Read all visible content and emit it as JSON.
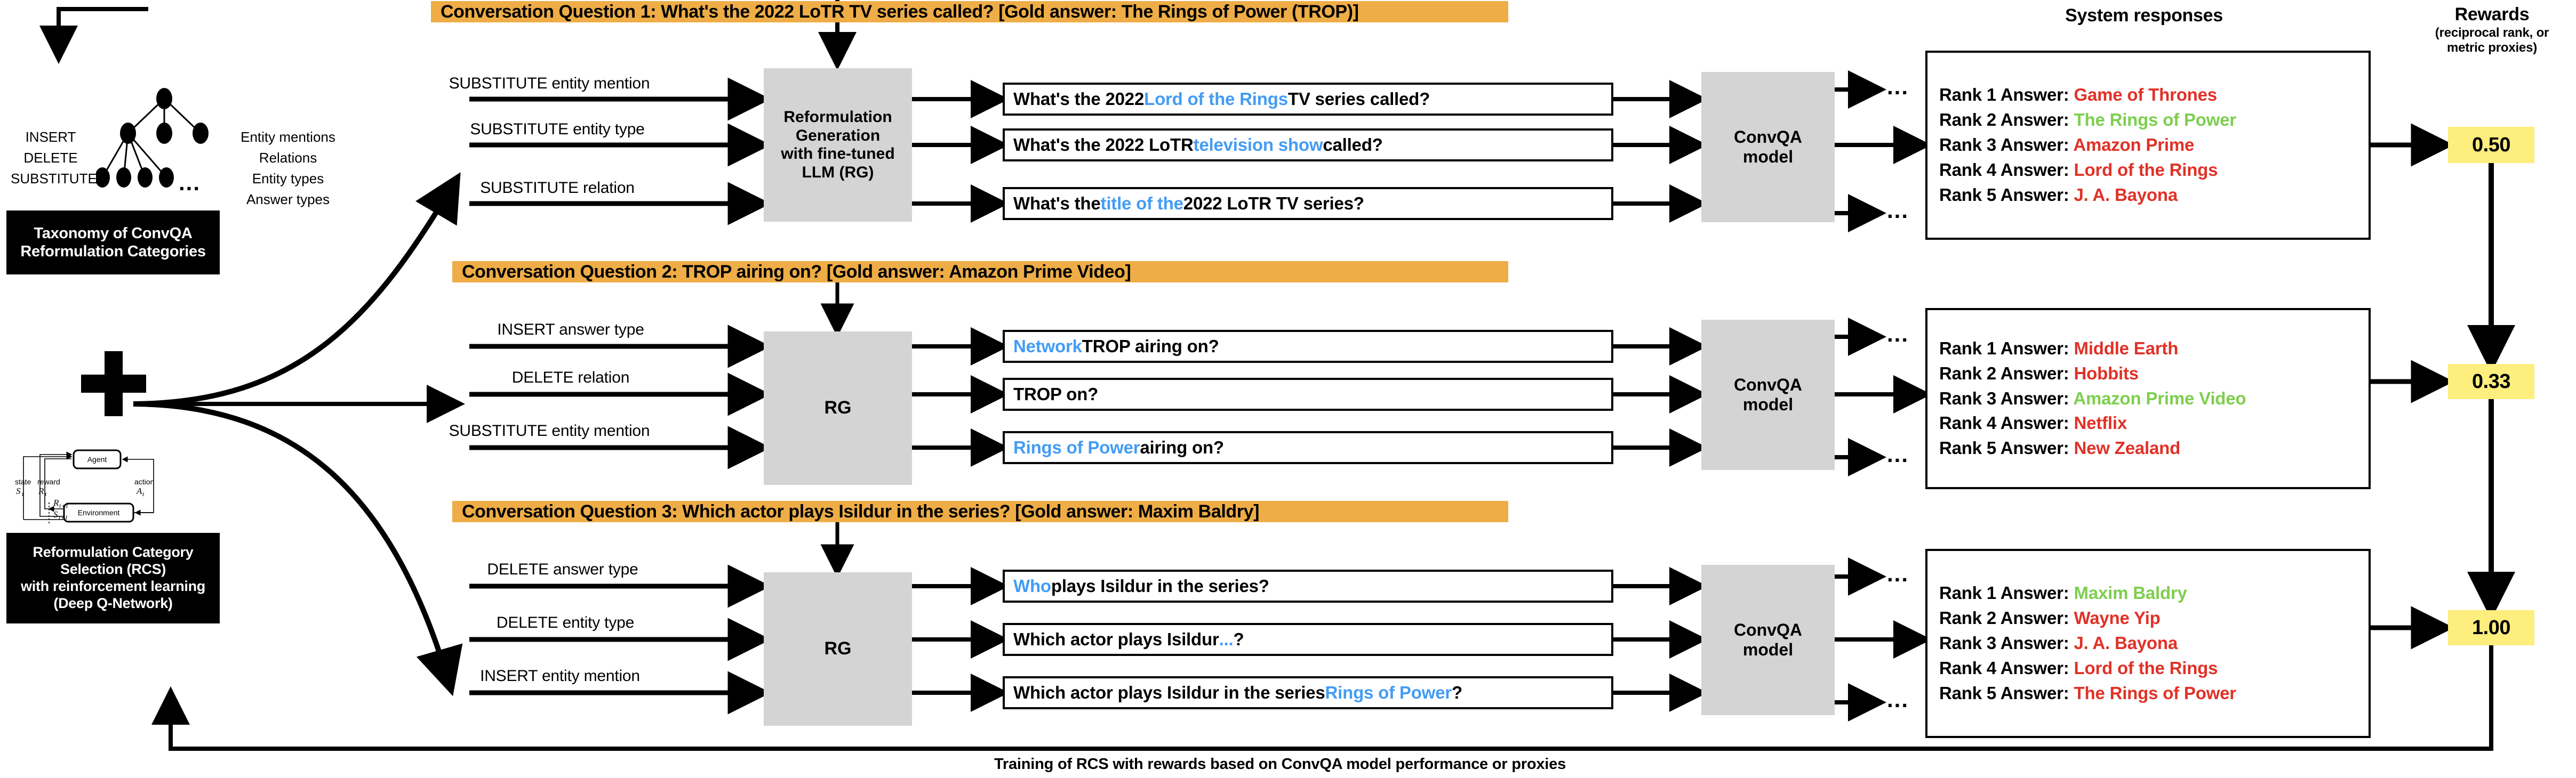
{
  "taxonomy": {
    "ops": [
      "INSERT",
      "DELETE",
      "SUBSTITUTE"
    ],
    "targets": [
      "Entity mentions",
      "Relations",
      "Entity types",
      "Answer types"
    ],
    "ellipsis": "...",
    "panel_label": "Taxonomy of ConvQA\nReformulation Categories",
    "panel_line1": "Taxonomy of ConvQA",
    "panel_line2": "Reformulation Categories"
  },
  "plus_sign": "+",
  "rcs": {
    "panel_line1": "Reformulation Category",
    "panel_line2": "Selection (RCS)",
    "panel_line3": "with reinforcement learning",
    "panel_line4": "(Deep Q-Network)",
    "rl_diagram": {
      "agent": "Agent",
      "environment": "Environment",
      "state_label": "state",
      "state_sym": "S",
      "state_sub": "t",
      "reward_label": "reward",
      "reward_sym": "R",
      "reward_sub": "t",
      "action_label": "action",
      "action_sym": "A",
      "action_sub": "t",
      "r_next": "R",
      "r_next_sub": "t+1",
      "s_next": "S",
      "s_next_sub": "t+1"
    }
  },
  "columns": {
    "responses_heading": "System responses",
    "rewards_heading": "Rewards",
    "rewards_subheading_line1": "(reciprocal rank, or",
    "rewards_subheading_line2": "metric proxies)"
  },
  "blocks": [
    {
      "banner": "Conversation Question 1: What's the 2022 LoTR TV series called? [Gold answer: The Rings of Power (TROP)]",
      "rg_box_lines": [
        "Reformulation",
        "Generation",
        "with fine-tuned",
        "LLM (RG)"
      ],
      "convqa_box_lines": [
        "ConvQA",
        "model"
      ],
      "edits": [
        "SUBSTITUTE entity mention",
        "SUBSTITUTE entity type",
        "SUBSTITUTE relation"
      ],
      "reformulations": [
        {
          "pre": "What's the 2022 ",
          "hl": "Lord of the Rings",
          "post": " TV series called?"
        },
        {
          "pre": "What's the 2022 LoTR ",
          "hl": "television show",
          "post": " called?"
        },
        {
          "pre": "What's the ",
          "hl": "title of the",
          "post": " 2022 LoTR TV series?"
        }
      ],
      "responses": [
        {
          "label": "Rank 1 Answer: ",
          "answer": "Game of Thrones",
          "correct": false
        },
        {
          "label": "Rank 2 Answer: ",
          "answer": "The Rings of Power",
          "correct": true
        },
        {
          "label": "Rank 3 Answer: ",
          "answer": "Amazon Prime",
          "correct": false
        },
        {
          "label": "Rank 4 Answer: ",
          "answer": "Lord of the Rings",
          "correct": false
        },
        {
          "label": "Rank 5 Answer: ",
          "answer": "J. A. Bayona",
          "correct": false
        }
      ],
      "reward": "0.50",
      "dots": "..."
    },
    {
      "banner": "Conversation Question 2: TROP airing on? [Gold answer: Amazon Prime Video]",
      "rg_box_lines": [
        "RG"
      ],
      "convqa_box_lines": [
        "ConvQA",
        "model"
      ],
      "edits": [
        "INSERT answer type",
        "DELETE relation",
        "SUBSTITUTE entity mention"
      ],
      "reformulations": [
        {
          "pre": "",
          "hl": "Network",
          "post": " TROP airing on?"
        },
        {
          "pre": "TROP on?",
          "hl": "",
          "post": ""
        },
        {
          "pre": "",
          "hl": "Rings of Power",
          "post": " airing on?"
        }
      ],
      "responses": [
        {
          "label": "Rank 1 Answer: ",
          "answer": "Middle Earth",
          "correct": false
        },
        {
          "label": "Rank 2 Answer: ",
          "answer": "Hobbits",
          "correct": false
        },
        {
          "label": "Rank 3 Answer: ",
          "answer": "Amazon Prime Video",
          "correct": true
        },
        {
          "label": "Rank 4 Answer: ",
          "answer": "Netflix",
          "correct": false
        },
        {
          "label": "Rank 5 Answer: ",
          "answer": "New Zealand",
          "correct": false
        }
      ],
      "reward": "0.33",
      "dots": "..."
    },
    {
      "banner": "Conversation Question 3: Which actor plays Isildur in the series? [Gold answer: Maxim Baldry]",
      "rg_box_lines": [
        "RG"
      ],
      "convqa_box_lines": [
        "ConvQA",
        "model"
      ],
      "edits": [
        "DELETE answer type",
        "DELETE entity type",
        "INSERT entity mention"
      ],
      "reformulations": [
        {
          "pre": "",
          "hl": "Who",
          "post": " plays Isildur in the series?"
        },
        {
          "pre": "Which actor plays Isildur ",
          "hl": "...",
          "post": "?"
        },
        {
          "pre": "Which actor plays Isildur in the series ",
          "hl": "Rings of Power",
          "post": "?"
        }
      ],
      "responses": [
        {
          "label": "Rank 1 Answer: ",
          "answer": "Maxim Baldry",
          "correct": true
        },
        {
          "label": "Rank 2 Answer: ",
          "answer": "Wayne Yip",
          "correct": false
        },
        {
          "label": "Rank 3 Answer: ",
          "answer": "J. A. Bayona",
          "correct": false
        },
        {
          "label": "Rank 4 Answer: ",
          "answer": "Lord of the Rings",
          "correct": false
        },
        {
          "label": "Rank 5 Answer: ",
          "answer": "The Rings of Power",
          "correct": false
        }
      ],
      "reward": "1.00",
      "dots": "..."
    }
  ],
  "footer_caption": "Training of RCS with rewards based on ConvQA model performance or proxies",
  "colors": {
    "banner_orange": "#eead47",
    "highlight_blue": "#439cf4",
    "answer_wrong_red": "#e03127",
    "answer_right_green": "#7ece4f",
    "reward_yellow": "#fdee7d",
    "gray_box": "#d4d4d4"
  }
}
